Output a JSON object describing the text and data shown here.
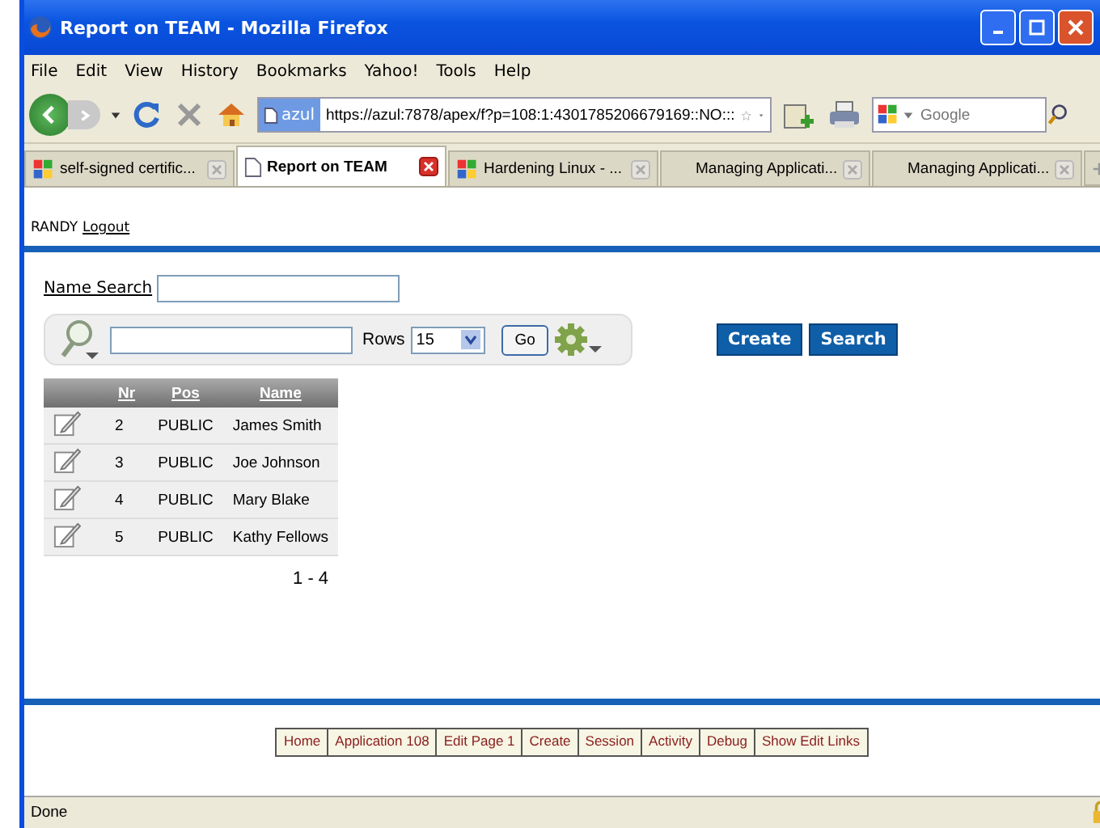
{
  "window": {
    "title": "Report on TEAM - Mozilla Firefox"
  },
  "menu": [
    "File",
    "Edit",
    "View",
    "History",
    "Bookmarks",
    "Yahoo!",
    "Tools",
    "Help"
  ],
  "toolbar": {
    "url_badge": "azul",
    "url": "https://azul:7878/apex/f?p=108:1:4301785206679169::NO:::",
    "search_placeholder": "Google"
  },
  "tabs": [
    {
      "label": "self-signed certific...",
      "selected": false,
      "kind": "google"
    },
    {
      "label": "Report on TEAM",
      "selected": true,
      "kind": "page"
    },
    {
      "label": "Hardening Linux - ...",
      "selected": false,
      "kind": "google"
    },
    {
      "label": "Managing Applicati...",
      "selected": false,
      "kind": "blank"
    },
    {
      "label": "Managing Applicati...",
      "selected": false,
      "kind": "blank"
    }
  ],
  "header": {
    "user": "RANDY",
    "logout": "Logout"
  },
  "name_search": {
    "label": "Name Search"
  },
  "report_bar": {
    "rows_label": "Rows",
    "rows_value": "15",
    "go": "Go"
  },
  "buttons": [
    "Create",
    "Search"
  ],
  "table": {
    "columns": [
      "Nr",
      "Pos",
      "Name"
    ],
    "rows": [
      [
        "2",
        "PUBLIC",
        "James Smith"
      ],
      [
        "3",
        "PUBLIC",
        "Joe Johnson"
      ],
      [
        "4",
        "PUBLIC",
        "Mary Blake"
      ],
      [
        "5",
        "PUBLIC",
        "Kathy Fellows"
      ]
    ],
    "pagination": "1 - 4"
  },
  "footer_links": [
    "Home",
    "Application 108",
    "Edit Page 1",
    "Create",
    "Session",
    "Activity",
    "Debug",
    "Show Edit Links"
  ],
  "status_bar": "Done"
}
